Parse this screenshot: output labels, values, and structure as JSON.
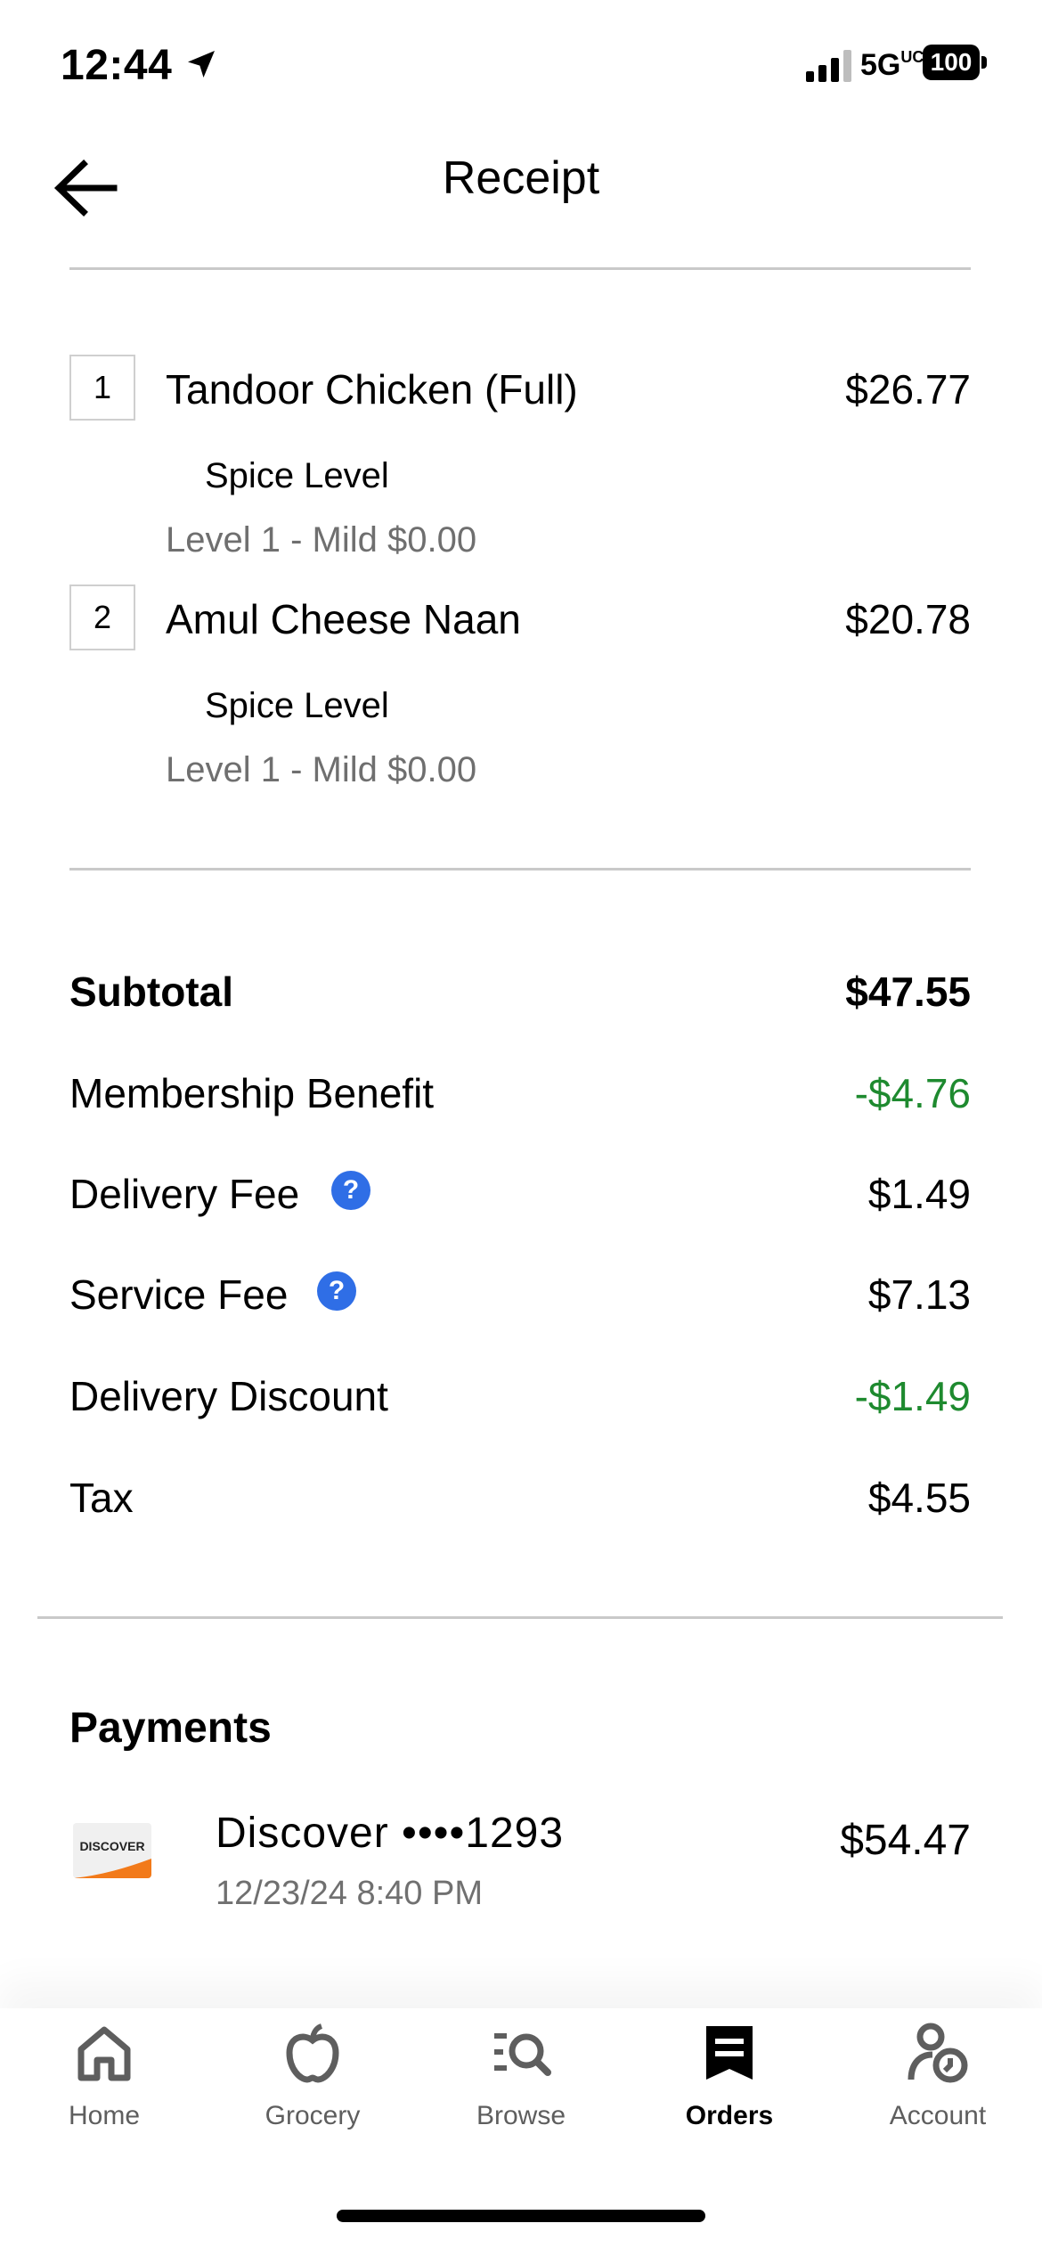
{
  "status_bar": {
    "time": "12:44",
    "network": "5G",
    "network_sup": "UC",
    "battery": "100"
  },
  "header": {
    "title": "Receipt"
  },
  "items": [
    {
      "qty": "1",
      "name": "Tandoor Chicken (Full)",
      "price": "$26.77",
      "option_title": "Spice Level",
      "option_value": "Level 1 - Mild $0.00"
    },
    {
      "qty": "2",
      "name": "Amul Cheese Naan",
      "price": "$20.78",
      "option_title": "Spice Level",
      "option_value": "Level 1 - Mild $0.00"
    }
  ],
  "totals": [
    {
      "label": "Subtotal",
      "value": "$47.55"
    },
    {
      "label": "Membership Benefit",
      "value": "-$4.76"
    },
    {
      "label": "Delivery Fee",
      "value": "$1.49"
    },
    {
      "label": "Service Fee",
      "value": "$7.13"
    },
    {
      "label": "Delivery Discount",
      "value": "-$1.49"
    },
    {
      "label": "Tax",
      "value": "$4.55"
    }
  ],
  "help_glyph": "?",
  "payments": {
    "title": "Payments",
    "card": {
      "logo_text": "DISCOVER",
      "name": "Discover ••••1293",
      "date": "12/23/24 8:40 PM",
      "amount": "$54.47"
    }
  },
  "nav": [
    {
      "label": "Home",
      "icon": "home-icon"
    },
    {
      "label": "Grocery",
      "icon": "apple-icon"
    },
    {
      "label": "Browse",
      "icon": "browse-search-icon"
    },
    {
      "label": "Orders",
      "icon": "receipt-icon",
      "active": true
    },
    {
      "label": "Account",
      "icon": "account-icon"
    }
  ],
  "colors": {
    "discount_green": "#1e8a2f",
    "help_blue": "#2f6ee6",
    "discover_orange": "#f27a1a"
  }
}
